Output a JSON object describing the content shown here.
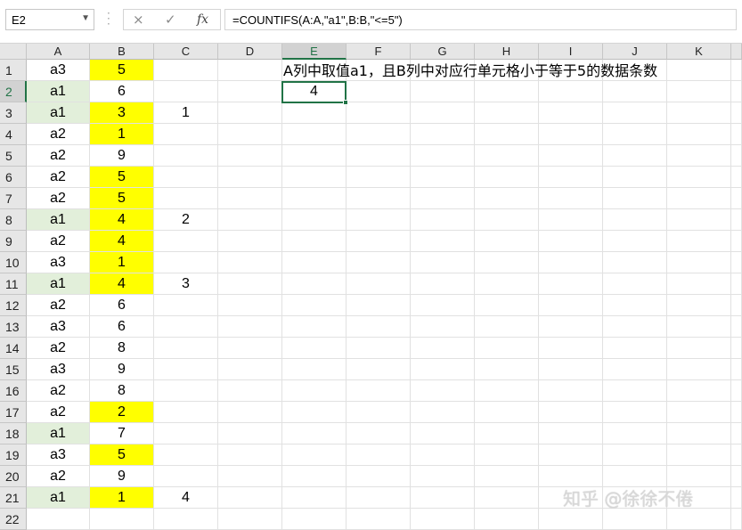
{
  "formula_bar": {
    "name_box": "E2",
    "cancel_icon": "×",
    "enter_icon": "✓",
    "fx_label": "fx",
    "formula": "=COUNTIFS(A:A,\"a1\",B:B,\"<=5\")"
  },
  "columns": [
    "A",
    "B",
    "C",
    "D",
    "E",
    "F",
    "G",
    "H",
    "I",
    "J",
    "K"
  ],
  "active_column": "E",
  "active_row": 2,
  "rows": [
    {
      "n": "1",
      "a": "a3",
      "b": "5",
      "c": "",
      "a_green": false,
      "b_yellow": true
    },
    {
      "n": "2",
      "a": "a1",
      "b": "6",
      "c": "",
      "a_green": true,
      "b_yellow": false
    },
    {
      "n": "3",
      "a": "a1",
      "b": "3",
      "c": "1",
      "a_green": true,
      "b_yellow": true
    },
    {
      "n": "4",
      "a": "a2",
      "b": "1",
      "c": "",
      "a_green": false,
      "b_yellow": true
    },
    {
      "n": "5",
      "a": "a2",
      "b": "9",
      "c": "",
      "a_green": false,
      "b_yellow": false
    },
    {
      "n": "6",
      "a": "a2",
      "b": "5",
      "c": "",
      "a_green": false,
      "b_yellow": true
    },
    {
      "n": "7",
      "a": "a2",
      "b": "5",
      "c": "",
      "a_green": false,
      "b_yellow": true
    },
    {
      "n": "8",
      "a": "a1",
      "b": "4",
      "c": "2",
      "a_green": true,
      "b_yellow": true
    },
    {
      "n": "9",
      "a": "a2",
      "b": "4",
      "c": "",
      "a_green": false,
      "b_yellow": true
    },
    {
      "n": "10",
      "a": "a3",
      "b": "1",
      "c": "",
      "a_green": false,
      "b_yellow": true
    },
    {
      "n": "11",
      "a": "a1",
      "b": "4",
      "c": "3",
      "a_green": true,
      "b_yellow": true
    },
    {
      "n": "12",
      "a": "a2",
      "b": "6",
      "c": "",
      "a_green": false,
      "b_yellow": false
    },
    {
      "n": "13",
      "a": "a3",
      "b": "6",
      "c": "",
      "a_green": false,
      "b_yellow": false
    },
    {
      "n": "14",
      "a": "a2",
      "b": "8",
      "c": "",
      "a_green": false,
      "b_yellow": false
    },
    {
      "n": "15",
      "a": "a3",
      "b": "9",
      "c": "",
      "a_green": false,
      "b_yellow": false
    },
    {
      "n": "16",
      "a": "a2",
      "b": "8",
      "c": "",
      "a_green": false,
      "b_yellow": false
    },
    {
      "n": "17",
      "a": "a2",
      "b": "2",
      "c": "",
      "a_green": false,
      "b_yellow": true
    },
    {
      "n": "18",
      "a": "a1",
      "b": "7",
      "c": "",
      "a_green": true,
      "b_yellow": false
    },
    {
      "n": "19",
      "a": "a3",
      "b": "5",
      "c": "",
      "a_green": false,
      "b_yellow": true
    },
    {
      "n": "20",
      "a": "a2",
      "b": "9",
      "c": "",
      "a_green": false,
      "b_yellow": false
    },
    {
      "n": "21",
      "a": "a1",
      "b": "1",
      "c": "4",
      "a_green": true,
      "b_yellow": true
    },
    {
      "n": "22",
      "a": "",
      "b": "",
      "c": "",
      "a_green": false,
      "b_yellow": false
    }
  ],
  "e1_note": "A列中取值a1，且B列中对应行单元格小于等于5的数据条数",
  "e2_value": "4",
  "watermark": "知乎 @徐徐不倦",
  "colors": {
    "green_fill": "#e2efda",
    "yellow_fill": "#ffff00",
    "selection": "#217346"
  }
}
